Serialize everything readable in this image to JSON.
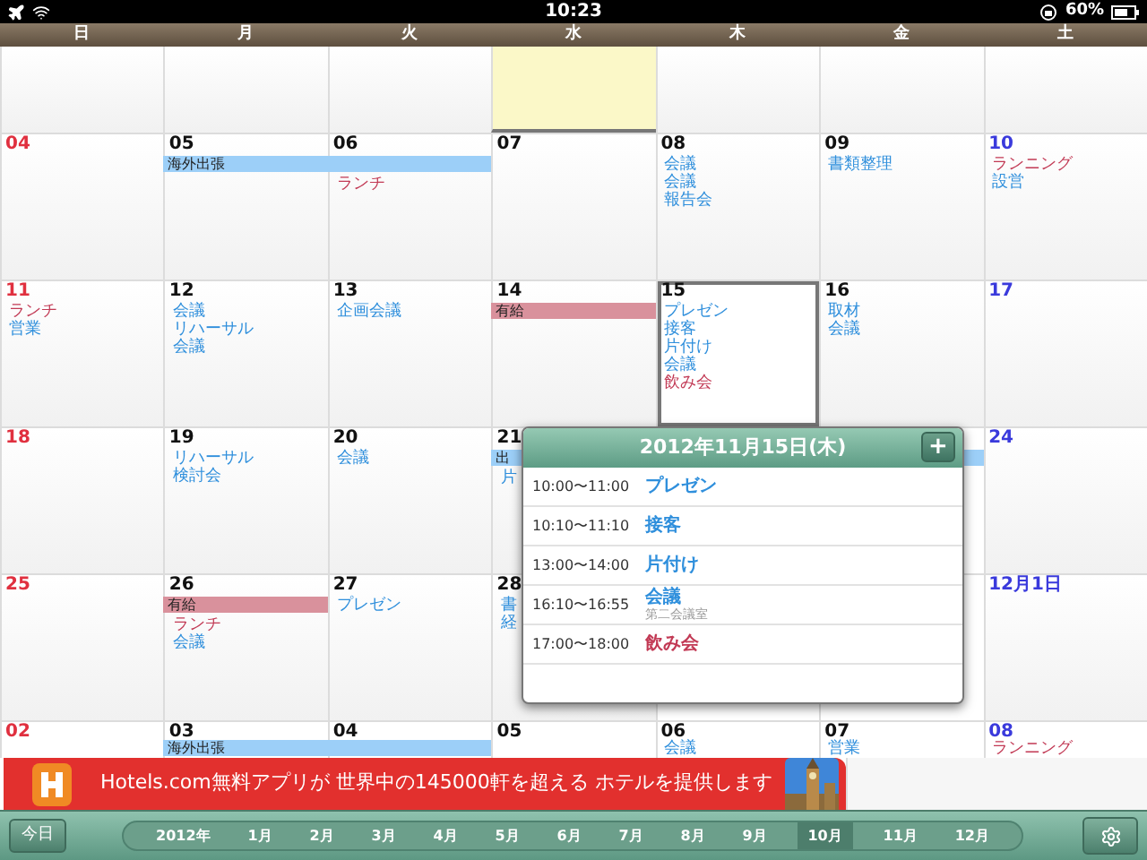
{
  "status_bar": {
    "time": "10:23",
    "battery": "60%"
  },
  "weekdays": [
    "日",
    "月",
    "火",
    "水",
    "木",
    "金",
    "土"
  ],
  "top_row": [
    {
      "highlighted": false
    },
    {
      "highlighted": false
    },
    {
      "highlighted": false
    },
    {
      "highlighted": true
    },
    {
      "highlighted": false
    },
    {
      "highlighted": false
    },
    {
      "highlighted": false
    }
  ],
  "weeks": [
    {
      "cells": [
        {
          "date": "04",
          "selected": false
        },
        {
          "date": "05",
          "selected": false,
          "bar": {
            "title": "海外出張",
            "color": "#9ccff8"
          }
        },
        {
          "date": "06",
          "selected": false,
          "bar": {
            "color": "#9ccff8"
          },
          "events": [
            {
              "title": "ランチ",
              "color": "#c23a55"
            }
          ]
        },
        {
          "date": "07",
          "selected": false
        },
        {
          "date": "08",
          "selected": false,
          "events": [
            {
              "title": "会議",
              "color": "#2f8fdc"
            },
            {
              "title": "会議",
              "color": "#2f8fdc"
            },
            {
              "title": "報告会",
              "color": "#2f8fdc"
            }
          ]
        },
        {
          "date": "09",
          "selected": false,
          "events": [
            {
              "title": "書類整理",
              "color": "#2f8fdc"
            }
          ]
        },
        {
          "date": "10",
          "selected": false,
          "events": [
            {
              "title": "ランニング",
              "color": "#c23a55"
            },
            {
              "title": "設営",
              "color": "#2f8fdc"
            }
          ]
        }
      ]
    },
    {
      "cells": [
        {
          "date": "11",
          "selected": false,
          "events": [
            {
              "title": "ランチ",
              "color": "#c23a55"
            },
            {
              "title": "営業",
              "color": "#2f8fdc"
            }
          ]
        },
        {
          "date": "12",
          "selected": false,
          "events": [
            {
              "title": "会議",
              "color": "#2f8fdc"
            },
            {
              "title": "リハーサル",
              "color": "#2f8fdc"
            },
            {
              "title": "会議",
              "color": "#2f8fdc"
            }
          ]
        },
        {
          "date": "13",
          "selected": false,
          "events": [
            {
              "title": "企画会議",
              "color": "#2f8fdc"
            }
          ]
        },
        {
          "date": "14",
          "selected": false,
          "bar": {
            "title": "有給",
            "color": "#d9919c"
          }
        },
        {
          "date": "15",
          "selected": true,
          "events": [
            {
              "title": "プレゼン",
              "color": "#2f8fdc"
            },
            {
              "title": "接客",
              "color": "#2f8fdc"
            },
            {
              "title": "片付け",
              "color": "#2f8fdc"
            },
            {
              "title": "会議",
              "color": "#2f8fdc"
            },
            {
              "title": "飲み会",
              "color": "#c23a55"
            }
          ]
        },
        {
          "date": "16",
          "selected": false,
          "events": [
            {
              "title": "取材",
              "color": "#2f8fdc"
            },
            {
              "title": "会議",
              "color": "#2f8fdc"
            }
          ]
        },
        {
          "date": "17",
          "selected": false
        }
      ]
    },
    {
      "cells": [
        {
          "date": "18",
          "selected": false
        },
        {
          "date": "19",
          "selected": false,
          "events": [
            {
              "title": "リハーサル",
              "color": "#2f8fdc"
            },
            {
              "title": "検討会",
              "color": "#2f8fdc"
            }
          ]
        },
        {
          "date": "20",
          "selected": false,
          "events": [
            {
              "title": "会議",
              "color": "#2f8fdc"
            }
          ]
        },
        {
          "date": "21",
          "selected": false,
          "bar": {
            "title": "出",
            "color": "#9ccff8"
          },
          "events": [
            {
              "title": "片",
              "color": "#2f8fdc"
            }
          ]
        },
        {
          "bar": {
            "color": "#9ccff8"
          }
        },
        {
          "bar": {
            "color": "#9ccff8"
          }
        },
        {
          "date": "24",
          "selected": false
        }
      ]
    },
    {
      "cells": [
        {
          "date": "25",
          "selected": false
        },
        {
          "date": "26",
          "selected": false,
          "bar": {
            "title": "有給",
            "color": "#d9919c"
          },
          "events": [
            {
              "title": "ランチ",
              "color": "#c23a55"
            },
            {
              "title": "会議",
              "color": "#2f8fdc"
            }
          ]
        },
        {
          "date": "27",
          "selected": false,
          "events": [
            {
              "title": "プレゼン",
              "color": "#2f8fdc"
            }
          ]
        },
        {
          "date": "28",
          "selected": false,
          "events": [
            {
              "title": "書",
              "color": "#2f8fdc"
            },
            {
              "title": "経",
              "color": "#2f8fdc"
            }
          ]
        },
        {},
        {},
        {
          "date": "12月1日",
          "selected": false
        }
      ]
    },
    {
      "cells": [
        {
          "date": "02"
        },
        {
          "date": "03",
          "bar": {
            "title": "海外出張",
            "color": "#9ccff8"
          }
        },
        {
          "date": "04",
          "bar": {
            "color": "#9ccff8"
          }
        },
        {
          "date": "05"
        },
        {
          "date": "06",
          "events": [
            {
              "title": "会議",
              "color": "#2f8fdc"
            }
          ]
        },
        {
          "date": "07",
          "events": [
            {
              "title": "営業",
              "color": "#2f8fdc"
            }
          ]
        },
        {
          "date": "08",
          "events": [
            {
              "title": "ランニング",
              "color": "#c23a55"
            }
          ]
        }
      ]
    }
  ],
  "popover": {
    "title": "2012年11月15日(木)",
    "add_button": "+",
    "items": [
      {
        "time": "10:00〜11:00",
        "title": "プレゼン",
        "color": "#2f8fdc"
      },
      {
        "time": "10:10〜11:10",
        "title": "接客",
        "color": "#2f8fdc"
      },
      {
        "time": "13:00〜14:00",
        "title": "片付け",
        "color": "#2f8fdc"
      },
      {
        "time": "16:10〜16:55",
        "title": "会議",
        "color": "#2f8fdc",
        "note": "第二会議室"
      },
      {
        "time": "17:00〜18:00",
        "title": "飲み会",
        "color": "#c23a55"
      }
    ]
  },
  "ad": {
    "text": "Hotels.com無料アプリが 世界中の145000軒を超える ホテルを提供します"
  },
  "toolbar": {
    "today_button": "今日",
    "months": [
      {
        "label": "2012年",
        "selected": false
      },
      {
        "label": "1月",
        "selected": false
      },
      {
        "label": "2月",
        "selected": false
      },
      {
        "label": "3月",
        "selected": false
      },
      {
        "label": "4月",
        "selected": false
      },
      {
        "label": "5月",
        "selected": false
      },
      {
        "label": "6月",
        "selected": false
      },
      {
        "label": "7月",
        "selected": false
      },
      {
        "label": "8月",
        "selected": false
      },
      {
        "label": "9月",
        "selected": false
      },
      {
        "label": "10月",
        "selected": true
      },
      {
        "label": "11月",
        "selected": false
      },
      {
        "label": "12月",
        "selected": false
      }
    ]
  }
}
